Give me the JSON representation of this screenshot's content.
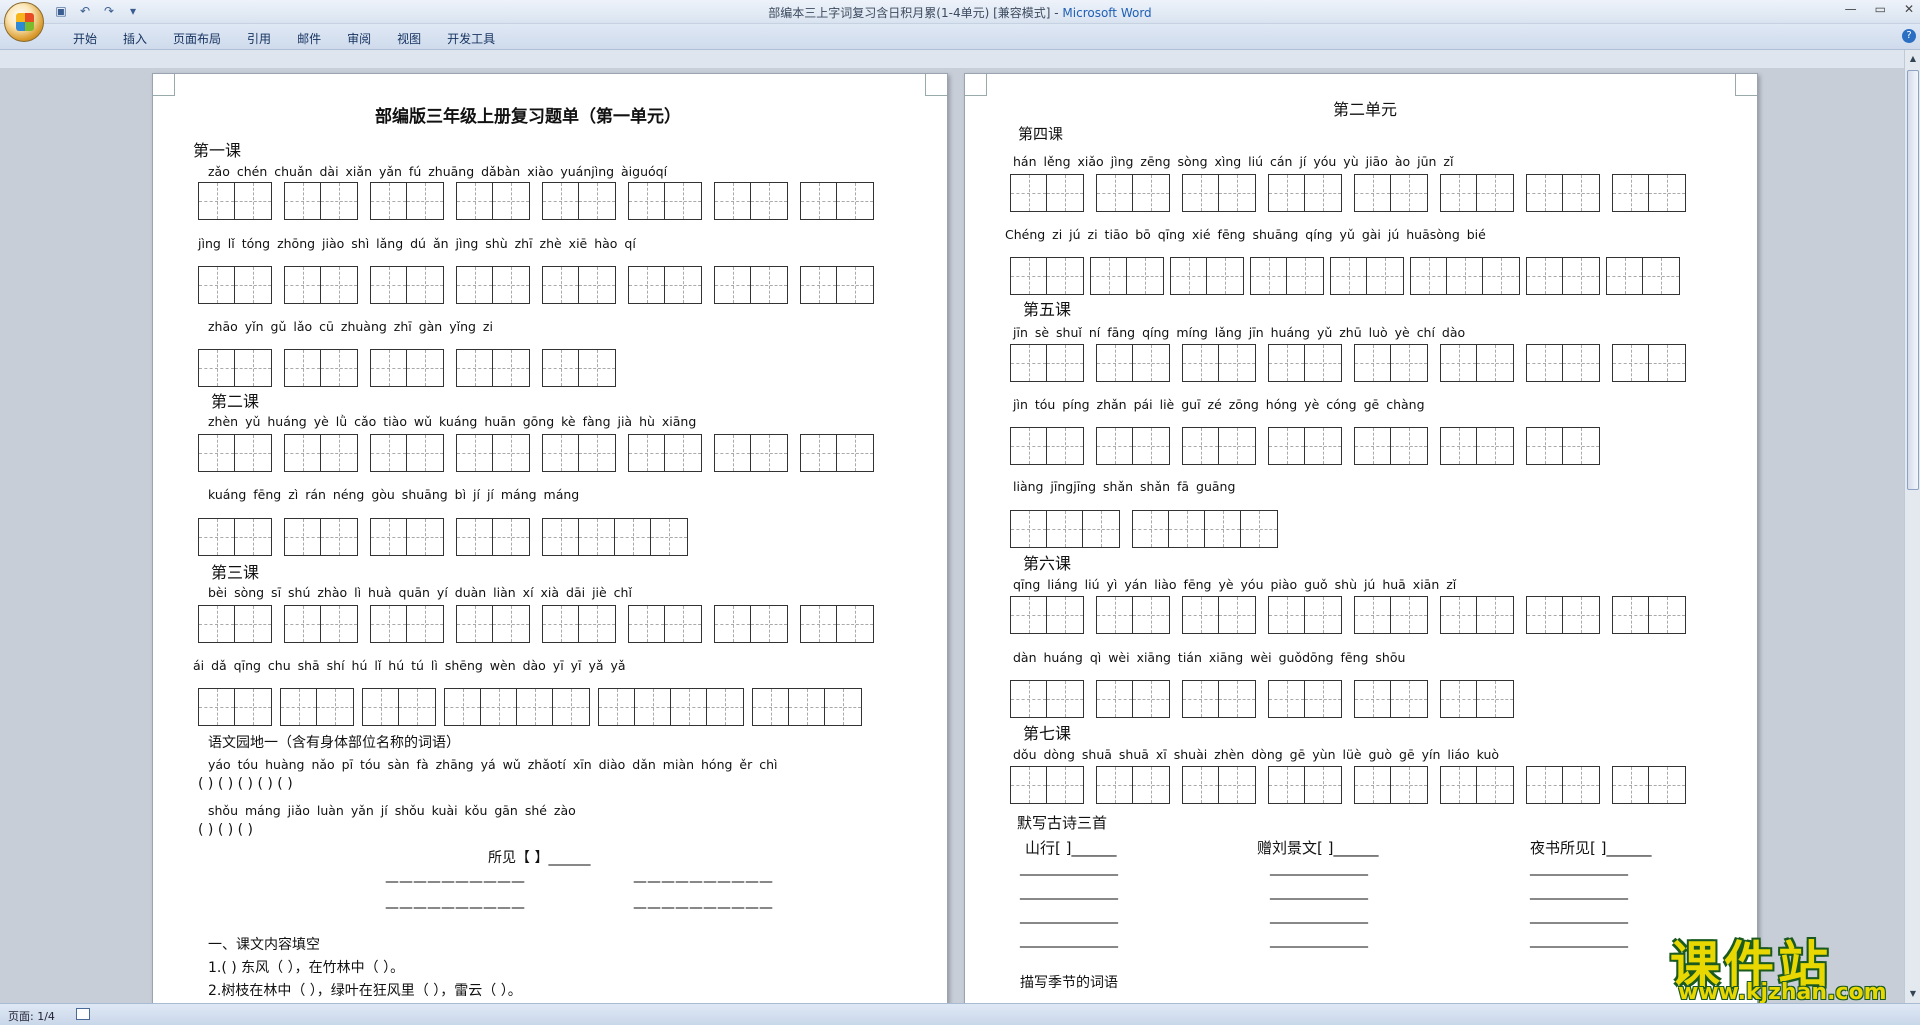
{
  "window": {
    "title": "部编本三上字词复习含日积月累(1-4单元) [兼容模式] - ",
    "app_name": "Microsoft Word"
  },
  "qat": [
    "save-icon",
    "undo-icon",
    "redo-icon",
    "customize-icon"
  ],
  "ribbon": {
    "tabs": [
      "开始",
      "插入",
      "页面布局",
      "引用",
      "邮件",
      "审阅",
      "视图",
      "开发工具"
    ]
  },
  "status": {
    "page": "页面: 1/4"
  },
  "watermark": {
    "top": "课件站",
    "url": "www.kjzhan.com"
  },
  "page1": {
    "title": "部编版三年级上册复习题单（第一单元）",
    "l1": "第一课",
    "p1": "zǎo chén    chuǎn dài    xiǎn yǎn    fú zhuāng   dǎbàn   xiào   yuánjìng  àiguóqí",
    "p2": "jìng  lǐ    tóng zhōng   jiào shì    lǎng dú    ǎn  jìng    shù  zhī    zhè  xiē     hào  qí",
    "p3": "zhāo yǐn     gǔ  lǎo     cū zhuàng    zhī  gàn    yǐng  zi",
    "l2": "第二课",
    "p4": "zhèn  yǔ     huáng yè    lǜ  cǎo     tiào  wǔ    kuáng huān   gōng kè      fàng  jià    hù  xiāng",
    "p5": "kuáng fēng      zì  rán     néng  gòu   shuāng bì      jí  jí  máng  máng",
    "l3": "第三课",
    "p6": "bèi sòng      sī  shú      zhào  lì      huà  quān    yí  duàn     liàn  xí     xià  dāi     jiè  chǐ",
    "p7": "ái dǎ     qīng chu    shā  shí      hú  lǐ     hú tú       lì shēng wèn dào      yī  yī  yǎ  yǎ",
    "yuandi": "语文园地一（含有身体部位名称的词语）",
    "p8": "yáo tóu huàng nǎo   pī tóu sàn fà    zhāng yá  wǔ zhǎotí xīn diào dǎn    miàn hóng ěr chì",
    "b8": "(               )    (               )    (                 )    (               )    (               )",
    "p9": "shǒu máng jiǎo luàn   yǎn jí shǒu kuài    kǒu gān shé zào",
    "b9": "(               )    (               )    (                )",
    "poem": "所见【    】______",
    "dash": "——————————",
    "fill_title": "一、课文内容填空",
    "fill1": "1.(          ) 东风（            ），在竹林中（             ）。",
    "fill2": "2.树枝在林中（            ），绿叶在狂风里（            ），雷云（            ）。"
  },
  "page2": {
    "title": "第二单元",
    "l4": "第四课",
    "p1": "hán lěng     xiǎo jìng     zēng sòng     xìng  liú     cán  jí      yóu  yù     jiāo  ào     jūn  zǐ",
    "p2": "Chéng  zi     jú  zi      tiāo  bō     qīng  xié   fēng shuāng   qíng  yǔ  gài     jú huāsòng bié",
    "l5": "第五课",
    "p3": "jīn  sè      shuǐ  ní     fāng qíng    míng lǎng     jīn huáng     yǔ  zhū     luò  yè      chí  dào",
    "p4": "jìn  tóu      píng zhǎn     pái  liè     guī  zé      zōng hóng     yè cóng         gē chàng",
    "p5": "liàng jīngjīng       shǎn shǎn fā  guāng",
    "l6": "第六课",
    "p6": "qīng liáng     liú  yì      yán  liào     fēng  yè     yóu  piào     guǒ  shù     jú  huā     xiān  zǐ",
    "p7": "dàn huáng     qì wèi      xiāng tián    xiāng wèi    guǒdōng     fēng shōu",
    "l7": "第七课",
    "p8": "dǒu dòng     shuā  shuā     xī shuài      zhèn dòng     gē yùn       lüè  guò     gē  yín       liáo kuò",
    "poems_title": "默写古诗三首",
    "poemA": "山行[     ]______",
    "poemB": "赠刘景文[     ]______",
    "poemC": "夜书所见[     ]______",
    "line": "______________",
    "seasons": "描写季节的词语"
  }
}
